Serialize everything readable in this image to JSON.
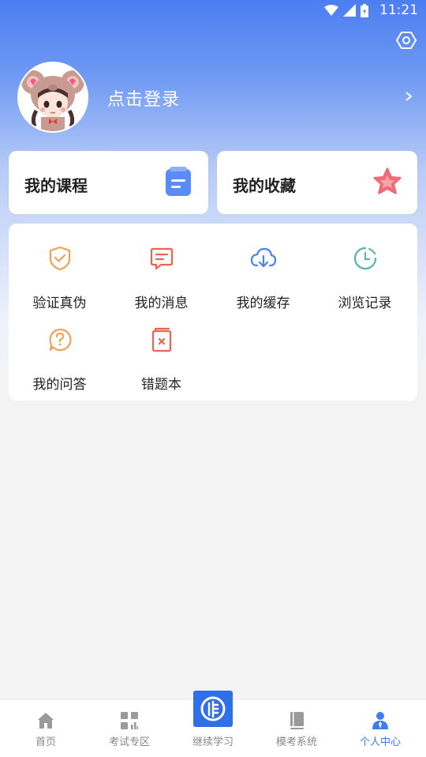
{
  "status_bar": {
    "time": "11:21"
  },
  "profile": {
    "login_label": "点击登录"
  },
  "cards": {
    "course": {
      "label": "我的课程"
    },
    "favorites": {
      "label": "我的收藏"
    }
  },
  "grid": [
    {
      "label": "验证真伪",
      "icon": "shield-check-icon"
    },
    {
      "label": "我的消息",
      "icon": "message-icon"
    },
    {
      "label": "我的缓存",
      "icon": "cloud-download-icon"
    },
    {
      "label": "浏览记录",
      "icon": "clock-icon"
    },
    {
      "label": "我的问答",
      "icon": "question-icon"
    },
    {
      "label": "错题本",
      "icon": "wrong-book-icon"
    }
  ],
  "bottom_nav": [
    {
      "label": "首页",
      "icon": "home-icon"
    },
    {
      "label": "考试专区",
      "icon": "grid-icon"
    },
    {
      "label": "继续学习",
      "icon": "study-icon"
    },
    {
      "label": "模考系统",
      "icon": "book-icon"
    },
    {
      "label": "个人中心",
      "icon": "person-icon",
      "active": true
    }
  ],
  "colors": {
    "accent": "#3d7cf2",
    "orange": "#f0a15a",
    "red": "#e8654f",
    "blue": "#4a82f0",
    "green": "#55b79c"
  }
}
